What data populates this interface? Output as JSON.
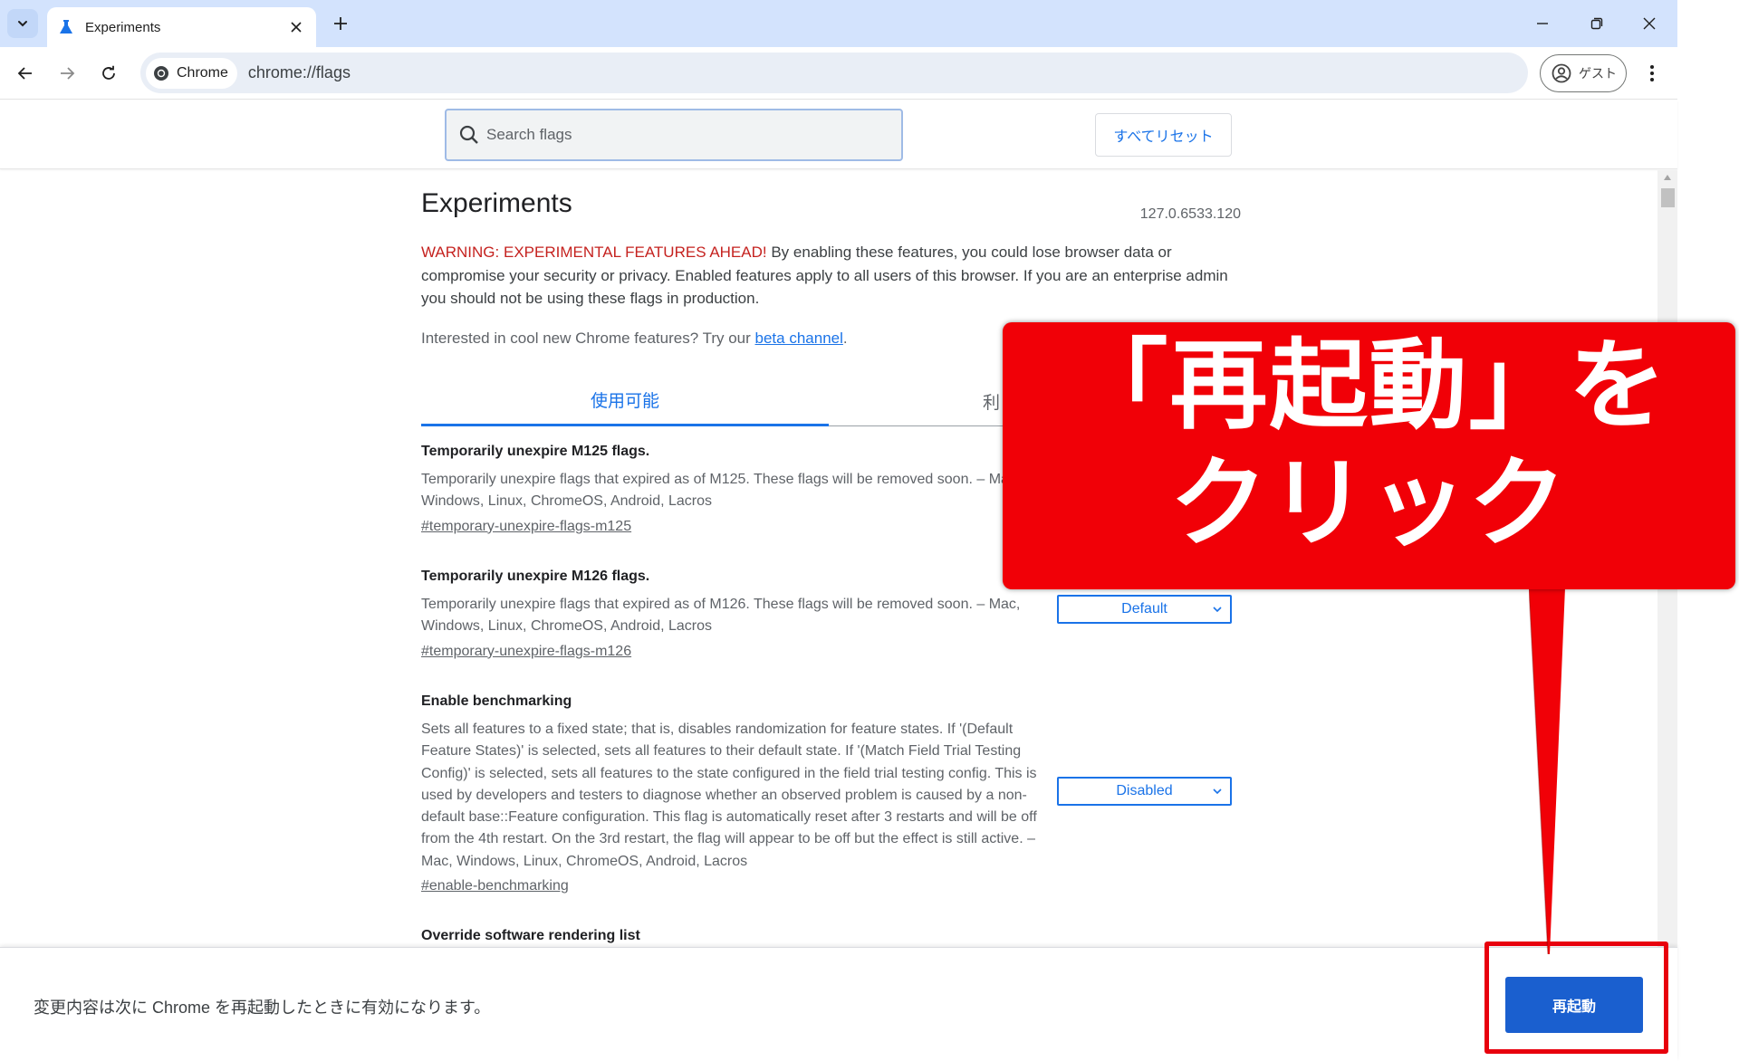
{
  "browser": {
    "tab_title": "Experiments",
    "omnibox_chip": "Chrome",
    "url": "chrome://flags",
    "profile_label": "ゲスト"
  },
  "flags": {
    "search_placeholder": "Search flags",
    "reset_all_label": "すべてリセット",
    "page_title": "Experiments",
    "version": "127.0.6533.120",
    "warning_red": "WARNING: EXPERIMENTAL FEATURES AHEAD!",
    "warning_rest": " By enabling these features, you could lose browser data or compromise your security or privacy. Enabled features apply to all users of this browser. If you are an enterprise admin you should not be using these flags in production.",
    "interest_prefix": "Interested in cool new Chrome features? Try our ",
    "interest_link": "beta channel",
    "interest_suffix": ".",
    "tabs": [
      {
        "label": "使用可能"
      },
      {
        "label": "利"
      }
    ],
    "experiments": [
      {
        "name": "Temporarily unexpire M125 flags.",
        "description": "Temporarily unexpire flags that expired as of M125. These flags will be removed soon. – Mac, Windows, Linux, ChromeOS, Android, Lacros",
        "link": "#temporary-unexpire-flags-m125",
        "value": ""
      },
      {
        "name": "Temporarily unexpire M126 flags.",
        "description": "Temporarily unexpire flags that expired as of M126. These flags will be removed soon. – Mac, Windows, Linux, ChromeOS, Android, Lacros",
        "link": "#temporary-unexpire-flags-m126",
        "value": "Default"
      },
      {
        "name": "Enable benchmarking",
        "description": "Sets all features to a fixed state; that is, disables randomization for feature states. If '(Default Feature States)' is selected, sets all features to their default state. If '(Match Field Trial Testing Config)' is selected, sets all features to the state configured in the field trial testing config. This is used by developers and testers to diagnose whether an observed problem is caused by a non-default base::Feature configuration. This flag is automatically reset after 3 restarts and will be off from the 4th restart. On the 3rd restart, the flag will appear to be off but the effect is still active. – Mac, Windows, Linux, ChromeOS, Android, Lacros",
        "link": "#enable-benchmarking",
        "value": "Disabled"
      },
      {
        "name": "Override software rendering list",
        "description": "",
        "link": "",
        "value": ""
      }
    ]
  },
  "relaunch": {
    "message": "変更内容は次に Chrome を再起動したときに有効になります。",
    "button_label": "再起動"
  },
  "callout": {
    "line1": "「再起動」を",
    "line2": "クリック",
    "color": "#f10007"
  }
}
